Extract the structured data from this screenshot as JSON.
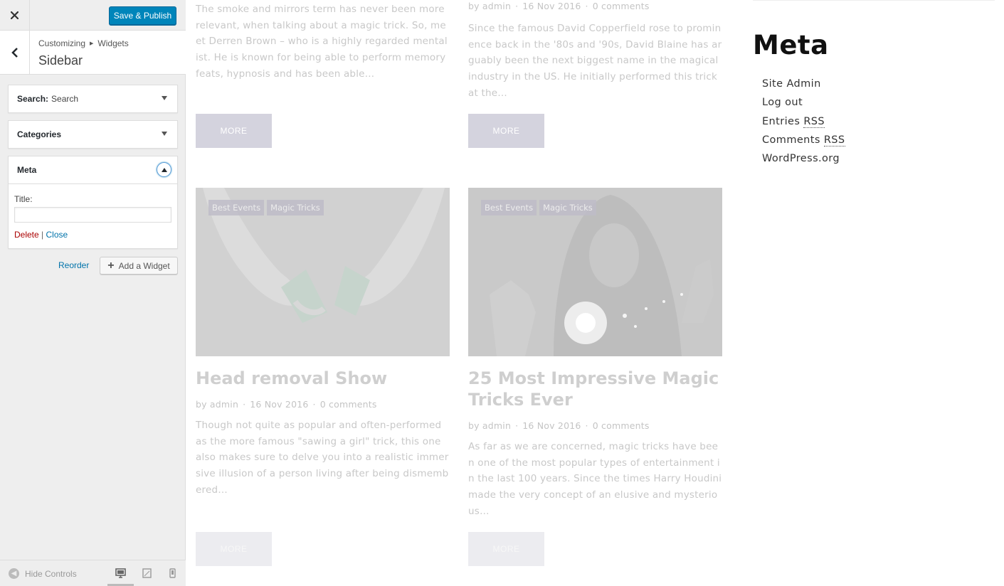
{
  "customizer": {
    "close_icon": "close-icon",
    "save_publish_label": "Save & Publish",
    "breadcrumb": {
      "first": "Customizing",
      "second": "Widgets"
    },
    "section_title": "Sidebar",
    "widgets": {
      "search": {
        "label": "Search:",
        "subtitle": "Search"
      },
      "categories": {
        "label": "Categories"
      },
      "meta": {
        "label": "Meta",
        "title_field_label": "Title:",
        "title_value": "",
        "delete_label": "Delete",
        "separator": "|",
        "close_label": "Close"
      }
    },
    "reorder_label": "Reorder",
    "add_widget_label": "Add a Widget",
    "footer": {
      "hide_controls_label": "Hide Controls",
      "devices": [
        "desktop-icon",
        "tablet-icon",
        "mobile-icon"
      ],
      "active_device": "desktop"
    },
    "accent_color": "#0085ba"
  },
  "preview": {
    "posts_top": [
      {
        "excerpt": "The smoke and mirrors term has never been more relevant, when talking about a magic trick. So, meet Derren Brown – who is a highly regarded mentalist. He is known for being able to perform memory feats, hypnosis and has been able…",
        "more_label": "MORE"
      },
      {
        "meta": {
          "author": "by admin",
          "date": "16 Nov 2016",
          "comments": "0 comments"
        },
        "excerpt": "Since the famous David Copperfield rose to prominence back in the '80s and '90s, David Blaine has arguably been the next biggest name in the magical industry in the US. He initially performed this trick at the…",
        "more_label": "MORE"
      }
    ],
    "posts_bottom": [
      {
        "categories": [
          "Best Events",
          "Magic Tricks"
        ],
        "title": "Head removal Show",
        "meta": {
          "author": "by admin",
          "date": "16 Nov 2016",
          "comments": "0 comments"
        },
        "excerpt": "Though not quite as popular and often-performed as the more famous \"sawing a girl\" trick, this one also makes sure to delve you into a realistic immersive illusion of a person living after being dismembered…",
        "more_label": "MORE"
      },
      {
        "categories": [
          "Best Events",
          "Magic Tricks"
        ],
        "title": "25 Most Impressive Magic Tricks Ever",
        "meta": {
          "author": "by admin",
          "date": "16 Nov 2016",
          "comments": "0 comments"
        },
        "excerpt": "As far as we are concerned, magic tricks have been one of the most popular types of entertainment in the last 100 years. Since the times Harry Houdini made the very concept of an elusive and mysterious…",
        "more_label": "MORE"
      }
    ],
    "meta_widget": {
      "heading": "Meta",
      "links": {
        "site_admin": "Site Admin",
        "log_out": "Log out",
        "entries_prefix": "Entries",
        "entries_abbr": "RSS",
        "comments_prefix": "Comments",
        "comments_abbr": "RSS",
        "wordpress": "WordPress.org"
      }
    }
  }
}
